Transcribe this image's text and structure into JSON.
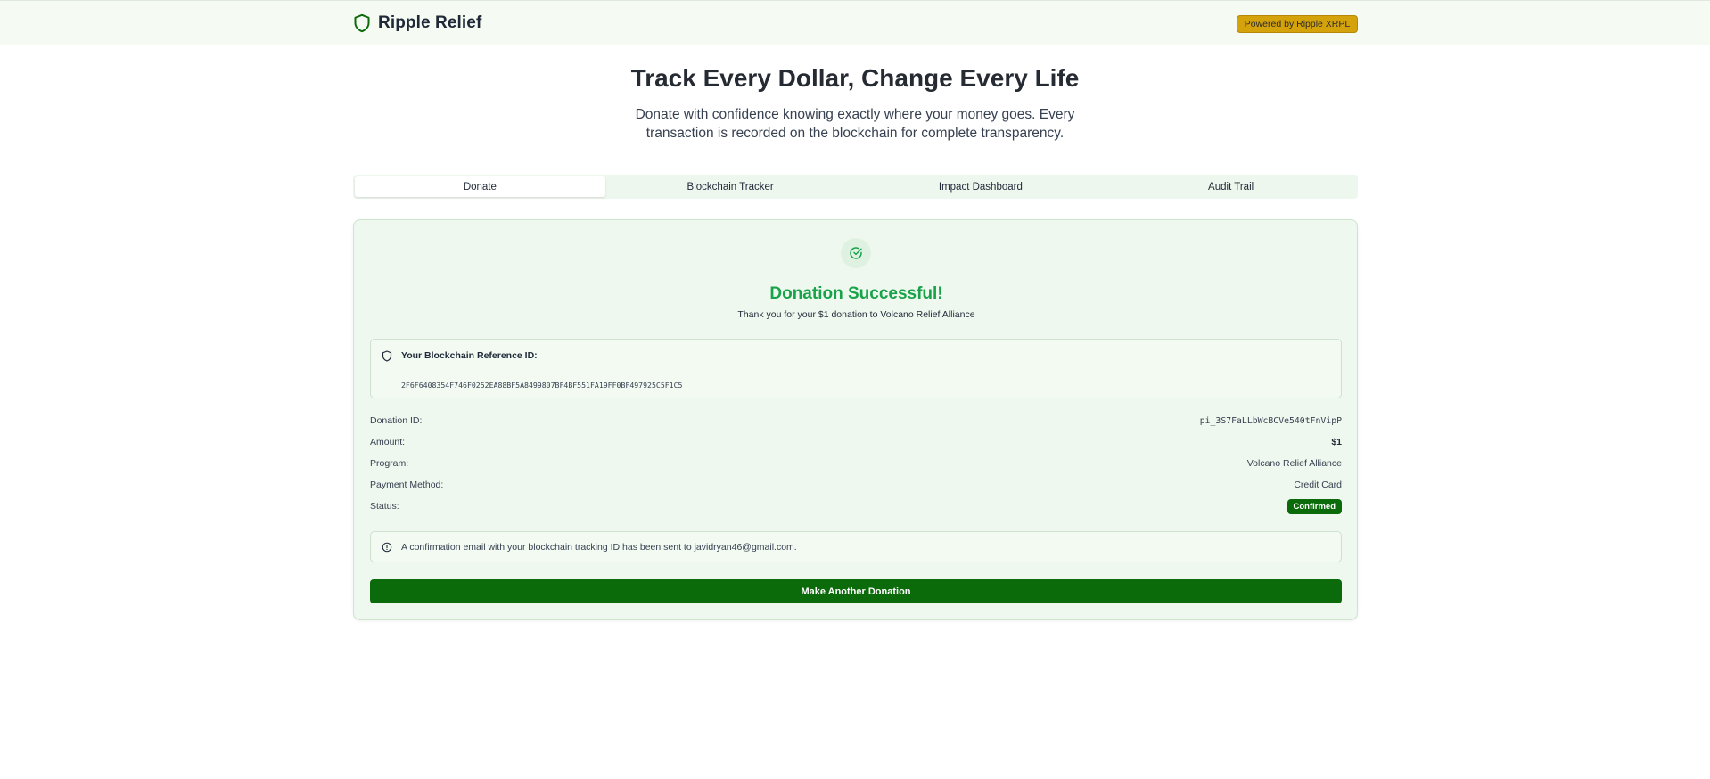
{
  "header": {
    "brand_name": "Ripple Relief",
    "powered_badge": "Powered by Ripple XRPL"
  },
  "hero": {
    "title": "Track Every Dollar, Change Every Life",
    "subtitle": "Donate with confidence knowing exactly where your money goes. Every transaction is recorded on the blockchain for complete transparency."
  },
  "tabs": [
    {
      "label": "Donate",
      "active": true
    },
    {
      "label": "Blockchain Tracker",
      "active": false
    },
    {
      "label": "Impact Dashboard",
      "active": false
    },
    {
      "label": "Audit Trail",
      "active": false
    }
  ],
  "success": {
    "title": "Donation Successful!",
    "message": "Thank you for your $1 donation to Volcano Relief Alliance"
  },
  "reference": {
    "label": "Your Blockchain Reference ID:",
    "hash": "2F6F6408354F746F0252EA88BF5A8499807BF4BF551FA19FF0BF497925C5F1C5"
  },
  "details": [
    {
      "label": "Donation ID:",
      "value": "pi_3S7FaLLbWcBCVe540tFnVipP"
    },
    {
      "label": "Amount:",
      "value": "$1"
    },
    {
      "label": "Program:",
      "value": "Volcano Relief Alliance"
    },
    {
      "label": "Payment Method:",
      "value": "Credit Card"
    },
    {
      "label": "Status:",
      "value": "Confirmed"
    }
  ],
  "info": {
    "text": "A confirmation email with your blockchain tracking ID has been sent to javidryan46@gmail.com."
  },
  "cta": {
    "label": "Make Another Donation"
  },
  "colors": {
    "brand_green": "#0b6b0b",
    "success_green": "#18a34a",
    "badge_gold": "#d4a20a"
  },
  "icons": {
    "brand": "shield-icon",
    "success": "check-circle-icon",
    "reference": "shield-icon",
    "info": "info-icon"
  }
}
